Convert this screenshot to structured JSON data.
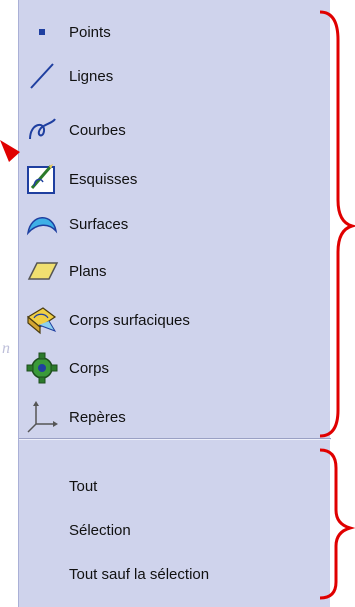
{
  "menu": {
    "items": [
      {
        "label": "Points",
        "icon": "point-icon"
      },
      {
        "label": "Lignes",
        "icon": "line-icon"
      },
      {
        "label": "Courbes",
        "icon": "curve-icon"
      },
      {
        "label": "Esquisses",
        "icon": "sketch-icon"
      },
      {
        "label": "Surfaces",
        "icon": "surface-icon"
      },
      {
        "label": "Plans",
        "icon": "plane-icon"
      },
      {
        "label": "Corps surfaciques",
        "icon": "surfacic-body-icon"
      },
      {
        "label": "Corps",
        "icon": "body-icon"
      },
      {
        "label": "Repères",
        "icon": "axis-system-icon"
      }
    ],
    "commands": [
      {
        "label": "Tout"
      },
      {
        "label": "Sélection"
      },
      {
        "label": "Tout sauf la sélection"
      }
    ]
  },
  "watermark": {
    "text": "n"
  },
  "colors": {
    "menu_background": "#cfd3ec",
    "annotation": "#e00000",
    "icon_blue": "#1f3fa0"
  }
}
